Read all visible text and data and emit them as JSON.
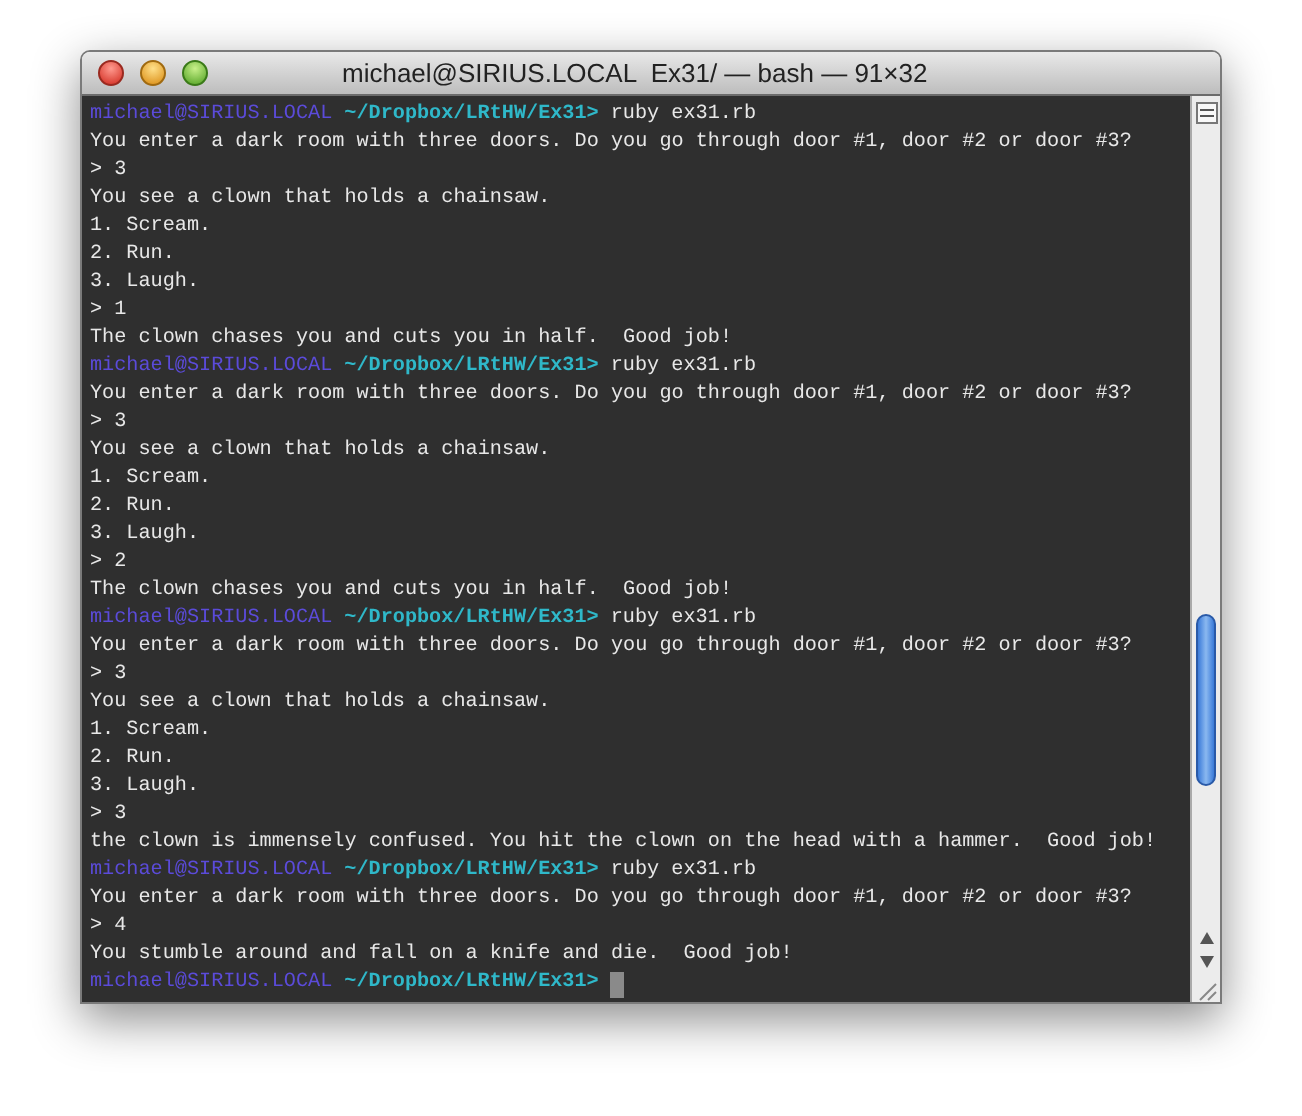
{
  "window": {
    "title": "michael@SIRIUS.LOCAL  Ex31/ — bash — 91×32"
  },
  "lines": [
    {
      "kind": "prompt",
      "user": "michael@SIRIUS.LOCAL",
      "path": "~/Dropbox/LRtHW/Ex31>",
      "command": "ruby ex31.rb"
    },
    {
      "kind": "text",
      "text": "You enter a dark room with three doors. Do you go through door #1, door #2 or door #3?"
    },
    {
      "kind": "text",
      "text": "> 3"
    },
    {
      "kind": "text",
      "text": "You see a clown that holds a chainsaw."
    },
    {
      "kind": "text",
      "text": "1. Scream."
    },
    {
      "kind": "text",
      "text": "2. Run."
    },
    {
      "kind": "text",
      "text": "3. Laugh."
    },
    {
      "kind": "text",
      "text": "> 1"
    },
    {
      "kind": "text",
      "text": "The clown chases you and cuts you in half.  Good job!"
    },
    {
      "kind": "prompt",
      "user": "michael@SIRIUS.LOCAL",
      "path": "~/Dropbox/LRtHW/Ex31>",
      "command": "ruby ex31.rb"
    },
    {
      "kind": "text",
      "text": "You enter a dark room with three doors. Do you go through door #1, door #2 or door #3?"
    },
    {
      "kind": "text",
      "text": "> 3"
    },
    {
      "kind": "text",
      "text": "You see a clown that holds a chainsaw."
    },
    {
      "kind": "text",
      "text": "1. Scream."
    },
    {
      "kind": "text",
      "text": "2. Run."
    },
    {
      "kind": "text",
      "text": "3. Laugh."
    },
    {
      "kind": "text",
      "text": "> 2"
    },
    {
      "kind": "text",
      "text": "The clown chases you and cuts you in half.  Good job!"
    },
    {
      "kind": "prompt",
      "user": "michael@SIRIUS.LOCAL",
      "path": "~/Dropbox/LRtHW/Ex31>",
      "command": "ruby ex31.rb"
    },
    {
      "kind": "text",
      "text": "You enter a dark room with three doors. Do you go through door #1, door #2 or door #3?"
    },
    {
      "kind": "text",
      "text": "> 3"
    },
    {
      "kind": "text",
      "text": "You see a clown that holds a chainsaw."
    },
    {
      "kind": "text",
      "text": "1. Scream."
    },
    {
      "kind": "text",
      "text": "2. Run."
    },
    {
      "kind": "text",
      "text": "3. Laugh."
    },
    {
      "kind": "text",
      "text": "> 3"
    },
    {
      "kind": "text",
      "text": "the clown is immensely confused. You hit the clown on the head with a hammer.  Good job!"
    },
    {
      "kind": "prompt",
      "user": "michael@SIRIUS.LOCAL",
      "path": "~/Dropbox/LRtHW/Ex31>",
      "command": "ruby ex31.rb"
    },
    {
      "kind": "text",
      "text": "You enter a dark room with three doors. Do you go through door #1, door #2 or door #3?"
    },
    {
      "kind": "text",
      "text": "> 4"
    },
    {
      "kind": "text",
      "text": "You stumble around and fall on a knife and die.  Good job!"
    },
    {
      "kind": "prompt",
      "user": "michael@SIRIUS.LOCAL",
      "path": "~/Dropbox/LRtHW/Ex31>",
      "cursor": true
    }
  ]
}
